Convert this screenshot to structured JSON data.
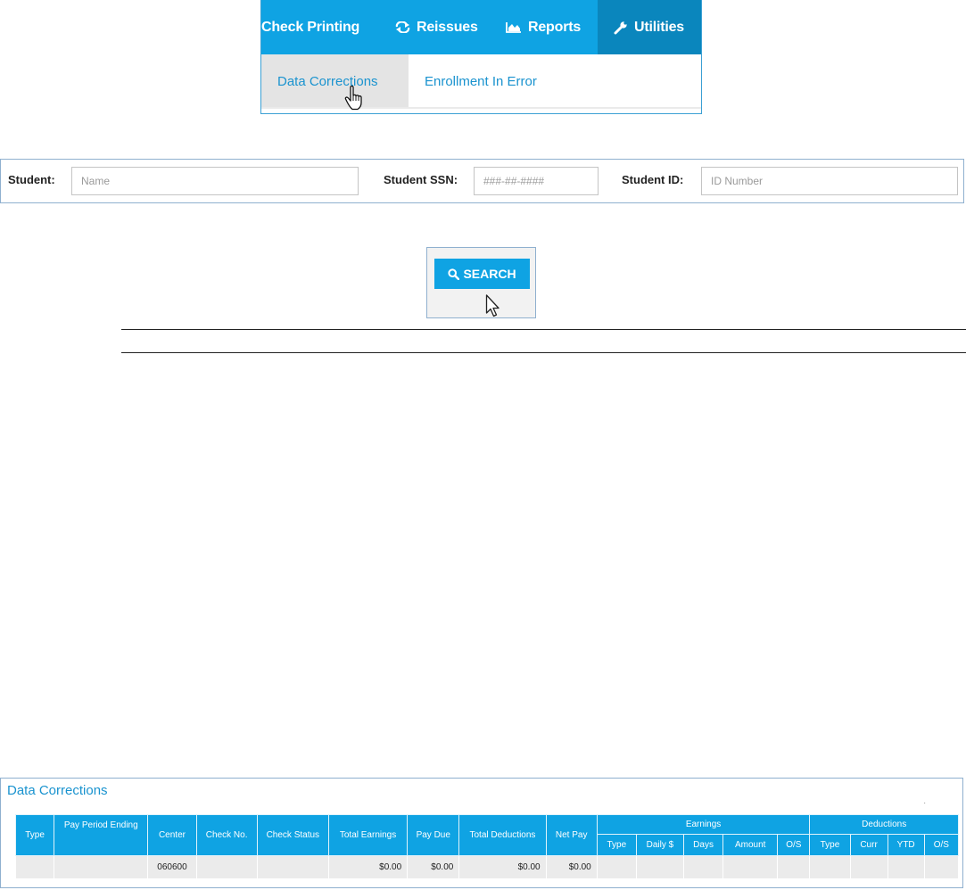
{
  "nav": {
    "items": [
      {
        "label": "Check Printing",
        "icon": "none"
      },
      {
        "label": "Reissues",
        "icon": "refresh-icon"
      },
      {
        "label": "Reports",
        "icon": "area-chart-icon"
      },
      {
        "label": "Utilities",
        "icon": "wrench-icon"
      }
    ],
    "submenu": [
      {
        "label": "Data Corrections",
        "active": true
      },
      {
        "label": "Enrollment In Error",
        "active": false
      }
    ]
  },
  "filters": {
    "student_label": "Student:",
    "student_placeholder": "Name",
    "ssn_label": "Student SSN:",
    "ssn_placeholder": "###-##-####",
    "id_label": "Student ID:",
    "id_placeholder": "ID Number"
  },
  "search": {
    "label": "SEARCH",
    "icon": "search-icon"
  },
  "data_corrections": {
    "title": "Data Corrections",
    "columns": [
      "Type",
      "Pay Period Ending",
      "Center",
      "Check No.",
      "Check Status",
      "Total Earnings",
      "Pay Due",
      "Total Deductions",
      "Net Pay"
    ],
    "earnings_group": "Earnings",
    "earnings_columns": [
      "Type",
      "Daily $",
      "Days",
      "Amount",
      "O/S"
    ],
    "deductions_group": "Deductions",
    "deductions_columns": [
      "Type",
      "Curr",
      "YTD",
      "O/S"
    ],
    "row": {
      "type": "",
      "pay_period_ending": "",
      "center": "060600",
      "check_no": "",
      "check_status": "",
      "total_earnings": "$0.00",
      "pay_due": "$0.00",
      "total_deductions": "$0.00",
      "net_pay": "$0.00"
    }
  },
  "colors": {
    "accent": "#0fa3e3",
    "accent_dark": "#0a86bd",
    "link": "#1a93cf"
  }
}
